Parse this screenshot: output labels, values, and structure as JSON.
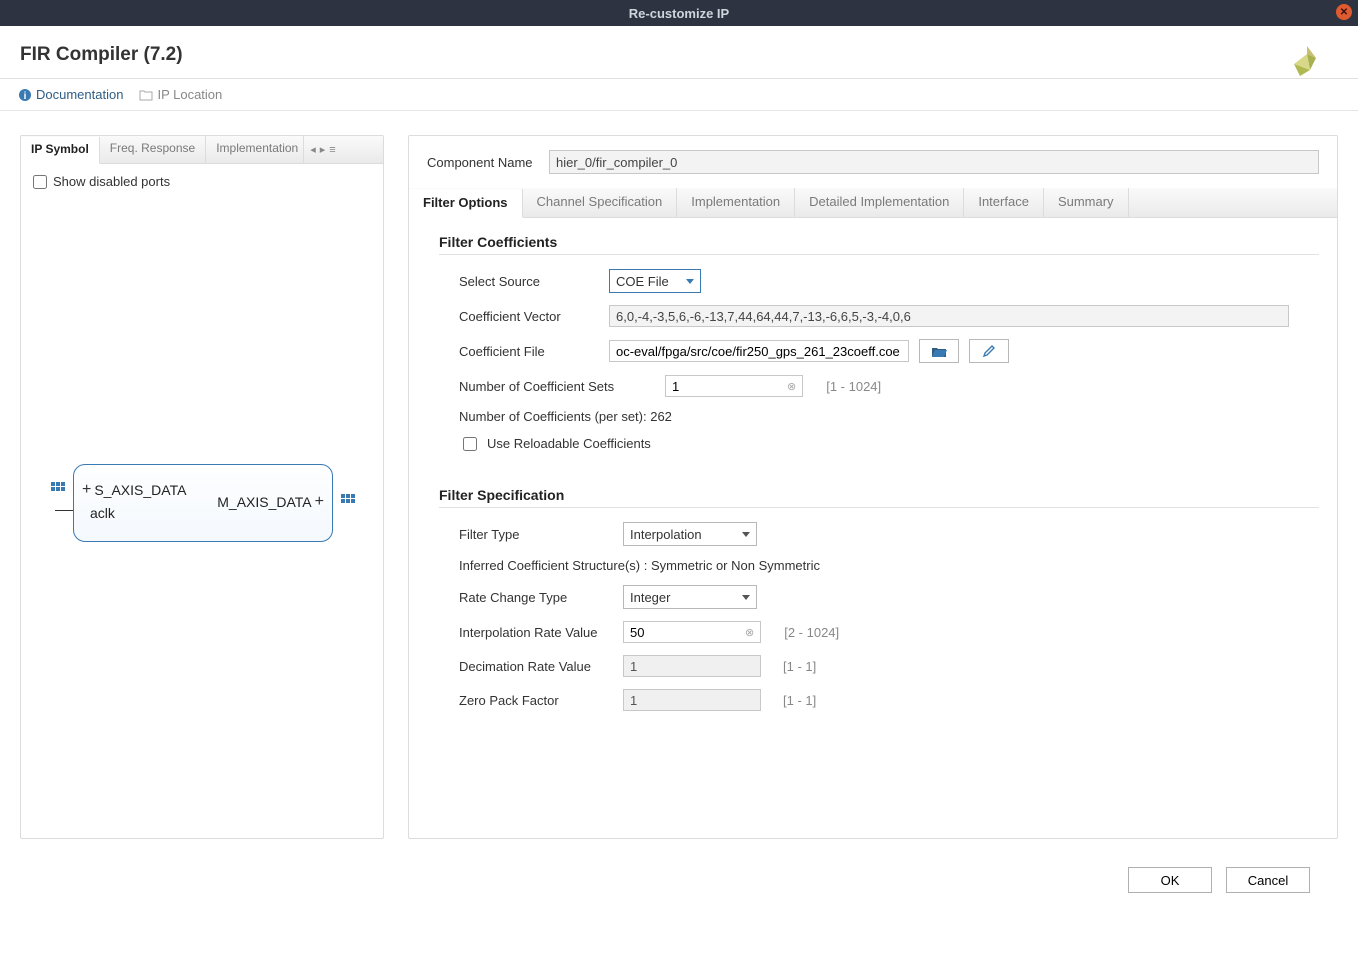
{
  "titlebar": {
    "title": "Re-customize IP"
  },
  "header": {
    "title": "FIR Compiler (7.2)"
  },
  "toolbar": {
    "doc": "Documentation",
    "iploc": "IP Location"
  },
  "left": {
    "tabs": [
      "IP Symbol",
      "Freq. Response",
      "Implementation"
    ],
    "show_disabled": "Show disabled ports",
    "ports": {
      "s_axis": "S_AXIS_DATA",
      "m_axis": "M_AXIS_DATA",
      "aclk": "aclk"
    }
  },
  "right": {
    "component_name_label": "Component Name",
    "component_name": "hier_0/fir_compiler_0",
    "tabs": [
      "Filter Options",
      "Channel Specification",
      "Implementation",
      "Detailed Implementation",
      "Interface",
      "Summary"
    ],
    "filter_coeff": {
      "heading": "Filter Coefficients",
      "select_source_label": "Select Source",
      "select_source_value": "COE File",
      "coeff_vector_label": "Coefficient Vector",
      "coeff_vector_value": "6,0,-4,-3,5,6,-6,-13,7,44,64,44,7,-13,-6,6,5,-3,-4,0,6",
      "coeff_file_label": "Coefficient File",
      "coeff_file_value": "oc-eval/fpga/src/coe/fir250_gps_261_23coeff.coe",
      "num_sets_label": "Number of Coefficient Sets",
      "num_sets_value": "1",
      "num_sets_range": "[1 - 1024]",
      "num_per_set": "Number of Coefficients (per set): 262",
      "reloadable": "Use Reloadable Coefficients"
    },
    "filter_spec": {
      "heading": "Filter Specification",
      "filter_type_label": "Filter Type",
      "filter_type_value": "Interpolation",
      "inferred": "Inferred Coefficient Structure(s) : Symmetric or Non Symmetric",
      "rate_change_label": "Rate Change Type",
      "rate_change_value": "Integer",
      "interp_label": "Interpolation Rate Value",
      "interp_value": "50",
      "interp_range": "[2 - 1024]",
      "decim_label": "Decimation Rate Value",
      "decim_value": "1",
      "decim_range": "[1 - 1]",
      "zero_label": "Zero Pack Factor",
      "zero_value": "1",
      "zero_range": "[1 - 1]"
    }
  },
  "footer": {
    "ok": "OK",
    "cancel": "Cancel"
  }
}
